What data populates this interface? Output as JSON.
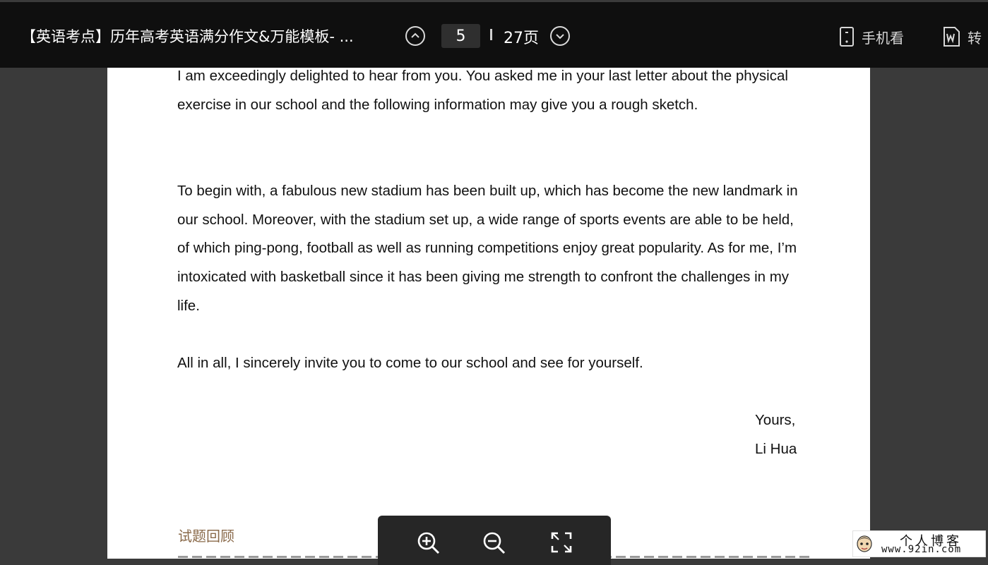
{
  "toolbar": {
    "title": "【英语考点】历年高考英语满分作文&万能模板- ...",
    "page_current": "5",
    "page_total": "27页",
    "actions": [
      {
        "label": "手机看",
        "icon": "phone-icon"
      },
      {
        "label": "转",
        "icon": "word-doc-icon"
      }
    ]
  },
  "document": {
    "paragraphs": [
      "I am exceedingly delighted to hear from you. You asked me in your last letter about the physical exercise in our school and the following information may give you a rough sketch.",
      "To begin with, a fabulous new stadium has been built up, which has become the new landmark in our school. Moreover, with the stadium set up, a wide range of sports events are able to be held, of which ping-pong, football as well as running competitions enjoy great popularity. As for me, I’m intoxicated with basketball since it has been giving me strength to confront the challenges in my life.",
      "All in all, I sincerely invite you to come to our school and see for yourself."
    ],
    "closing": "Yours,",
    "signature": "Li Hua",
    "next_section_heading": "试题回顾"
  },
  "zoom_toolbar": {
    "buttons": [
      "zoom-in-icon",
      "zoom-out-icon",
      "fullscreen-icon"
    ]
  },
  "watermark": {
    "title": "个人博客",
    "url": "www.92in.com"
  },
  "colors": {
    "toolbar_bg": "#0f0f0f",
    "viewer_bg": "#3a3a3a",
    "page_bg": "#ffffff",
    "heading_accent": "#8a6a4a"
  }
}
